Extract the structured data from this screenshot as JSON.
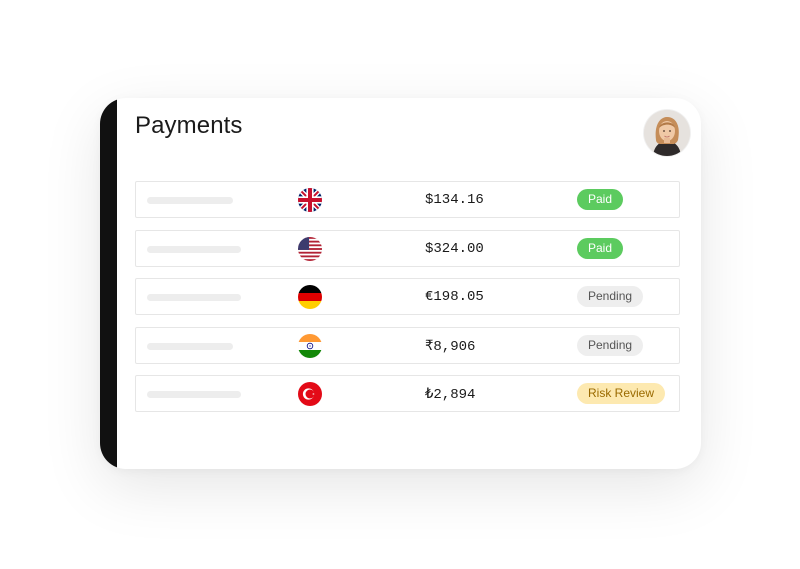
{
  "page": {
    "title": "Payments"
  },
  "colors": {
    "paid": "#5ccb5f",
    "pending": "#eeeeee",
    "risk": "#fde9b0",
    "edge": "#111111"
  },
  "payments": [
    {
      "flag": "uk-flag-icon",
      "amount": "$134.16",
      "status": "Paid",
      "status_type": "paid"
    },
    {
      "flag": "us-flag-icon",
      "amount": "$324.00",
      "status": "Paid",
      "status_type": "paid"
    },
    {
      "flag": "germany-flag-icon",
      "amount": "€198.05",
      "status": "Pending",
      "status_type": "pending"
    },
    {
      "flag": "india-flag-icon",
      "amount": "₹8,906",
      "status": "Pending",
      "status_type": "pending"
    },
    {
      "flag": "turkey-flag-icon",
      "amount": "₺2,894",
      "status": "Risk Review",
      "status_type": "risk"
    }
  ]
}
